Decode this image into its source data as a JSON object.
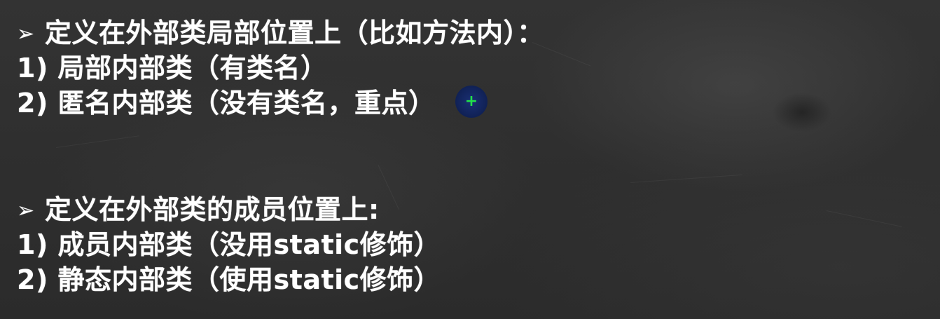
{
  "slide": {
    "section1": {
      "bullet": "➢",
      "title": "定义在外部类局部位置上（比如方法内）：",
      "items": [
        "1) 局部内部类（有类名）",
        "2) 匿名内部类（没有类名，重点）"
      ]
    },
    "section2": {
      "bullet": "➢",
      "title": "定义在外部类的成员位置上:",
      "items": [
        "1) 成员内部类（没用static修饰）",
        "2) 静态内部类（使用static修饰）"
      ]
    }
  },
  "cursor": {
    "icon": "crosshair-plus-icon",
    "glyph": "+",
    "color": "#22e04a",
    "ring_color": "#12245c"
  },
  "colors": {
    "text": "#ffffff",
    "background": "#2f2f2f"
  }
}
